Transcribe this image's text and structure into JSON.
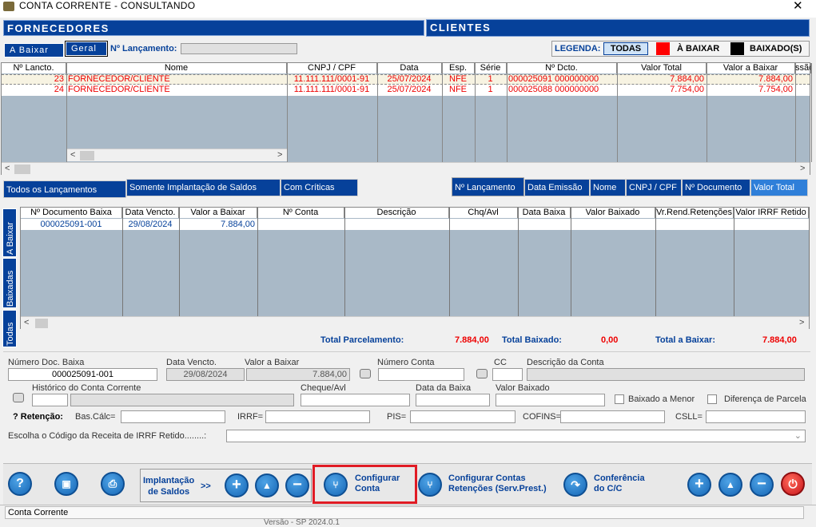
{
  "window": {
    "title": "CONTA CORRENTE   -   CONSULTANDO",
    "close": "✕"
  },
  "header": {
    "suppliers": "FORNECEDORES",
    "clients": "CLIENTES"
  },
  "tabs": {
    "a_baixar": "A Baixar",
    "geral": "Geral"
  },
  "lancamento_label": "Nº Lançamento:",
  "legend": {
    "label": "LEGENDA:",
    "todas": "TODAS",
    "a_baixar": "À BAIXAR",
    "baixados": "BAIXADO(S)",
    "colors": {
      "a_baixar": "#ff0000",
      "baixados": "#000000"
    }
  },
  "grid1": {
    "headers": [
      "Nº Lancto.",
      "Nome",
      "CNPJ / CPF",
      "Data",
      "Esp.",
      "Série",
      "Nº Dcto.",
      "Valor Total",
      "Valor a Baixar",
      "ssão"
    ],
    "rows": [
      {
        "num": "23",
        "nome": "FORNECEDOR/CLIENTE",
        "cnpj": "11.111.111/0001-91",
        "data": "25/07/2024",
        "esp": "NFE",
        "serie": "1",
        "dcto": "000025091     000000000",
        "total": "7.884,00",
        "baixar": "7.884,00"
      },
      {
        "num": "24",
        "nome": "FORNECEDOR/CLIENTE",
        "cnpj": "11.111.111/0001-91",
        "data": "25/07/2024",
        "esp": "NFE",
        "serie": "1",
        "dcto": "000025088     000000000",
        "total": "7.754,00",
        "baixar": "7.754,00"
      }
    ]
  },
  "filters": {
    "todos": "Todos os Lançamentos",
    "somente": "Somente Implantação de Saldos",
    "criticas": "Com Críticas"
  },
  "sort": {
    "lancamento": "Nº Lançamento",
    "emissao": "Data Emissão",
    "nome": "Nome",
    "cnpj": "CNPJ / CPF",
    "documento": "Nº Documento",
    "valor": "Valor Total"
  },
  "vtabs": {
    "a_baixar": "A Baixar",
    "baixadas": "Baixadas",
    "todas": "Todas"
  },
  "grid2": {
    "headers": [
      "Nº Documento Baixa",
      "Data Vencto.",
      "Valor a Baixar",
      "Nº Conta",
      "Descrição",
      "Chq/Avl",
      "Data Baixa",
      "Valor Baixado",
      "Vr.Rend.Retenções",
      "Valor IRRF Retido"
    ],
    "rows": [
      {
        "doc": "000025091-001",
        "venc": "29/08/2024",
        "valor": "7.884,00"
      }
    ]
  },
  "totals": {
    "parcelamento_label": "Total Parcelamento:",
    "parcelamento": "7.884,00",
    "baixado_label": "Total Baixado:",
    "baixado": "0,00",
    "a_baixar_label": "Total a Baixar:",
    "a_baixar": "7.884,00"
  },
  "form": {
    "num_doc_label": "Número Doc. Baixa",
    "num_doc": "000025091-001",
    "venc_label": "Data Vencto.",
    "venc": "29/08/2024",
    "valor_label": "Valor a Baixar",
    "valor": "7.884,00",
    "conta_label": "Número Conta",
    "cc_label": "CC",
    "desc_label": "Descrição da Conta",
    "hist_label": "Histórico do Conta Corrente",
    "cheque_label": "Cheque/Avl",
    "data_baixa_label": "Data da Baixa",
    "valor_baixado_label": "Valor Baixado",
    "baixado_menor": "Baixado a Menor",
    "diferenca": "Diferença de Parcela",
    "retencao": "? Retenção:",
    "bascalc": "Bas.Cálc=",
    "irrf": "IRRF=",
    "pis": "PIS=",
    "cofins": "COFINS=",
    "csll": "CSLL=",
    "receita": "Escolha o Código da Receita de IRRF Retido........:"
  },
  "toolbar": {
    "implantacao": "Implantação\nde Saldos",
    "arrows": ">>",
    "configurar": "Configurar\nConta",
    "config_ret": "Configurar Contas\nRetenções (Serv.Prest.)",
    "conferencia": "Conferência\ndo C/C",
    "help": "?"
  },
  "status": {
    "text": "Conta Corrente",
    "bottom": "Versão - SP 2024.0.1"
  }
}
